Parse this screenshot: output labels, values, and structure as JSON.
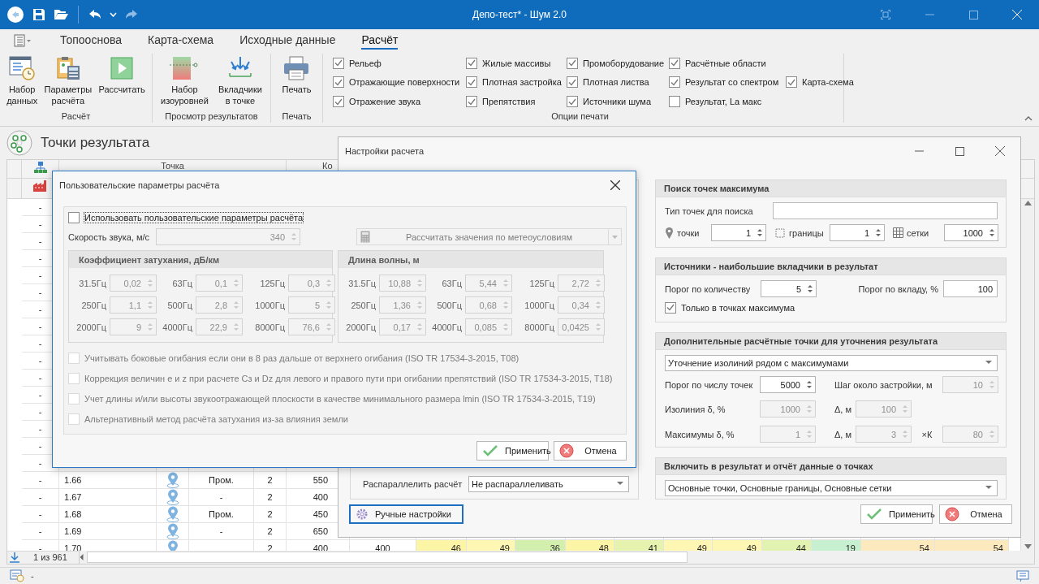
{
  "window": {
    "title": "Депо-тест* - Шум 2.0"
  },
  "ribbon": {
    "tabs": [
      {
        "label": "Топооснова",
        "selected": false
      },
      {
        "label": "Карта-схема",
        "selected": false
      },
      {
        "label": "Исходные данные",
        "selected": false
      },
      {
        "label": "Расчёт",
        "selected": true
      }
    ],
    "groups": [
      {
        "label": "Расчёт",
        "buttons": [
          {
            "kind": "dataset",
            "label": "Набор\nданных"
          },
          {
            "kind": "params",
            "label": "Параметры\nрасчёта"
          },
          {
            "kind": "run",
            "label": "Рассчитать"
          }
        ]
      },
      {
        "label": "Просмотр результатов",
        "buttons": [
          {
            "kind": "isolevels",
            "label": "Набор\nизоуровней"
          },
          {
            "kind": "contributors",
            "label": "Вкладчики\nв точке"
          }
        ]
      },
      {
        "label": "Печать",
        "buttons": [
          {
            "kind": "print",
            "label": "Печать"
          }
        ]
      }
    ],
    "print_options": {
      "label": "Опции печати",
      "rows": [
        [
          {
            "label": "Рельеф",
            "checked": true
          },
          {
            "label": "Жилые массивы",
            "checked": true
          },
          {
            "label": "Промоборудование",
            "checked": true
          },
          {
            "label": "Расчётные области",
            "checked": true
          }
        ],
        [
          {
            "label": "Отражающие поверхности",
            "checked": true
          },
          {
            "label": "Плотная застройка",
            "checked": true
          },
          {
            "label": "Плотная листва",
            "checked": true
          },
          {
            "label": "Результат со спектром",
            "checked": true
          },
          {
            "label": "Карта-схема",
            "checked": true
          }
        ],
        [
          {
            "label": "Отражение звука",
            "checked": true
          },
          {
            "label": "Препятствия",
            "checked": true
          },
          {
            "label": "Источники шума",
            "checked": true
          },
          {
            "label": "Результат, La макс",
            "checked": false
          }
        ]
      ]
    }
  },
  "panel": {
    "title": "Точки результата"
  },
  "table": {
    "header": [
      "Точка",
      "Ко"
    ],
    "pager": "1 из 961",
    "rows": [
      {
        "marker": "-"
      },
      {
        "marker": "-"
      },
      {
        "marker": "-"
      },
      {
        "marker": "-"
      },
      {
        "marker": "-"
      },
      {
        "marker": "-"
      },
      {
        "marker": "-"
      },
      {
        "marker": "-"
      },
      {
        "marker": "-"
      },
      {
        "marker": "-"
      },
      {
        "marker": "-"
      },
      {
        "marker": "-"
      },
      {
        "marker": "-"
      },
      {
        "marker": "-"
      },
      {
        "marker": "-"
      },
      {
        "marker": "-"
      },
      {
        "marker": "-",
        "number": "1.66",
        "type": "Пром.",
        "col_5": "2",
        "col_6": "550"
      },
      {
        "marker": "-",
        "number": "1.67",
        "type": "-",
        "col_5": "2",
        "col_6": "400"
      },
      {
        "marker": "-",
        "number": "1.68",
        "type": "Пром.",
        "col_5": "2",
        "col_6": "450"
      },
      {
        "marker": "-",
        "number": "1.69",
        "type": "-",
        "col_5": "2",
        "col_6": "650"
      },
      {
        "marker": "-",
        "number": "1.70",
        "col_5": "2",
        "col_6": "400",
        "col_7": "400",
        "levels": [
          {
            "value": "46",
            "color": "#fdf5a6"
          },
          {
            "value": "49",
            "color": "#fef7b4"
          },
          {
            "value": "36",
            "color": "#d3efad"
          },
          {
            "value": "48",
            "color": "#fdf5a6"
          },
          {
            "value": "41",
            "color": "#e6f3ae"
          },
          {
            "value": "49",
            "color": "#fef7b4"
          },
          {
            "value": "49",
            "color": "#fef7b4"
          },
          {
            "value": "44",
            "color": "#e2f2b0"
          },
          {
            "value": "19",
            "color": "#c6f0cf"
          },
          {
            "value": "54",
            "color": "#fce9bd"
          },
          {
            "value": "54",
            "color": "#fce9bd"
          }
        ]
      }
    ]
  },
  "status_bar": {
    "text": "-"
  },
  "settings_dialog": {
    "title": "Настройки расчета",
    "parallel": {
      "label": "Распараллелить расчёт",
      "value": "Не распараллеливать"
    },
    "manual_button": "Ручные настройки",
    "sections": [
      {
        "kind": "search",
        "title": "Поиск точек максимума",
        "type_label": "Тип точек для поиска",
        "counts": [
          {
            "kind": "pin",
            "label": "точки",
            "value": "1"
          },
          {
            "kind": "frame",
            "label": "границы",
            "value": "1"
          },
          {
            "kind": "grid",
            "label": "сетки",
            "value": "1000"
          }
        ]
      },
      {
        "kind": "sources",
        "title": "Источники - наибольшие вкладчики в результат",
        "count_label": "Порог по количеству",
        "count_value": "5",
        "share_label": "Порог по вкладу, %",
        "share_value": "100",
        "only_max": {
          "label": "Только в точках максимума",
          "checked": true
        }
      },
      {
        "kind": "refine",
        "title": "Дополнительные расчётные точки для уточнения результата",
        "mode": "Уточнение изолиний рядом с максимумами",
        "rows": [
          [
            {
              "kind": "main",
              "label": "Порог по числу точек",
              "value": "5000",
              "disabled": false
            },
            {
              "kind": "wide",
              "label": "Шаг около застройки, м",
              "value": "10",
              "disabled": true
            }
          ],
          [
            {
              "kind": "main",
              "label": "Изолиния δ, %",
              "value": "1000",
              "disabled": true
            },
            {
              "kind": "short",
              "label": "Δ, м",
              "value": "100",
              "disabled": true
            }
          ],
          [
            {
              "kind": "main",
              "label": "Максимумы δ, %",
              "value": "1",
              "disabled": true
            },
            {
              "kind": "short",
              "label": "Δ, м",
              "value": "3",
              "disabled": true
            },
            {
              "kind": "factor",
              "label": "×К",
              "value": "80",
              "disabled": true
            }
          ]
        ]
      },
      {
        "kind": "include",
        "title": "Включить в результат и отчёт данные о точках",
        "value": "Основные точки, Основные границы, Основные сетки"
      }
    ],
    "buttons": [
      {
        "kind": "apply",
        "label": "Применить"
      },
      {
        "kind": "cancel",
        "label": "Отмена"
      }
    ]
  },
  "params_dialog": {
    "title": "Пользовательские параметры расчёта",
    "use_custom": {
      "label": "Использовать пользовательские параметры расчёта",
      "checked": false
    },
    "speed": {
      "label": "Скорость звука, м/с",
      "value": "340",
      "disabled": true
    },
    "meteo_button": {
      "label": "Рассчитать значения по метеоусловиям",
      "disabled": true
    },
    "groups": [
      {
        "title": "Коэффициент затухания, дБ/км",
        "disabled": true,
        "cells": [
          {
            "label": "31.5Гц",
            "value": "0,02"
          },
          {
            "label": "63Гц",
            "value": "0,1"
          },
          {
            "label": "125Гц",
            "value": "0,3"
          },
          {
            "label": "250Гц",
            "value": "1,1"
          },
          {
            "label": "500Гц",
            "value": "2,8"
          },
          {
            "label": "1000Гц",
            "value": "5"
          },
          {
            "label": "2000Гц",
            "value": "9"
          },
          {
            "label": "4000Гц",
            "value": "22,9"
          },
          {
            "label": "8000Гц",
            "value": "76,6"
          }
        ]
      },
      {
        "title": "Длина волны, м",
        "disabled": true,
        "cells": [
          {
            "label": "31.5Гц",
            "value": "10,88"
          },
          {
            "label": "63Гц",
            "value": "5,44"
          },
          {
            "label": "125Гц",
            "value": "2,72"
          },
          {
            "label": "250Гц",
            "value": "1,36"
          },
          {
            "label": "500Гц",
            "value": "0,68"
          },
          {
            "label": "1000Гц",
            "value": "0,34"
          },
          {
            "label": "2000Гц",
            "value": "0,17"
          },
          {
            "label": "4000Гц",
            "value": "0,085"
          },
          {
            "label": "8000Гц",
            "value": "0,0425"
          }
        ]
      }
    ],
    "options": [
      {
        "label": "Учитывать боковые огибания если они в 8 раз дальше от верхнего огибания (ISO TR 17534-3-2015, T08)",
        "checked": false,
        "disabled": true
      },
      {
        "label": "Коррекция величин е и z при расчете Cз и Dz для левого и правого пути при огибании препятствий (ISO TR 17534-3-2015, T18)",
        "checked": false,
        "disabled": true
      },
      {
        "label": "Учет длины и/или высоты звукоотражающей плоскости в качестве минимального размера lmin (ISO TR 17534-3-2015, T19)",
        "checked": false,
        "disabled": true
      },
      {
        "label": "Альтернативный метод расчёта затухания из-за влияния земли",
        "checked": false,
        "disabled": true
      }
    ],
    "buttons": [
      {
        "kind": "apply",
        "label": "Применить"
      },
      {
        "kind": "cancel",
        "label": "Отмена"
      }
    ]
  }
}
